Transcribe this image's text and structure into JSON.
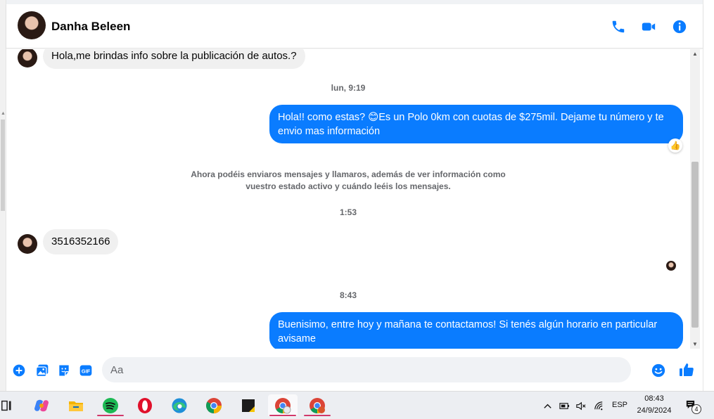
{
  "header": {
    "contact_name": "Danha Beleen",
    "accent_color": "#0a7cff"
  },
  "messages": {
    "incoming_1": "Hola,me brindas info sobre la publicación de autos.?",
    "timestamp_1": "lun, 9:19",
    "outgoing_1_line1": "Hola!! como estas? 😊Es un Polo 0km con cuotas de $275mil. Dejame tu número y te",
    "outgoing_1_line2": "envio mas información",
    "reaction_1": "👍",
    "notice_line1": "Ahora podéis enviaros mensajes y llamaros, además de ver información como",
    "notice_line2": "vuestro estado activo y cuándo leéis los mensajes.",
    "timestamp_2": "1:53",
    "incoming_2": "3516352166",
    "timestamp_3": "8:43",
    "outgoing_2_line1": "Buenisimo, entre hoy y mañana te contactamos! Si tenés algún horario en particular",
    "outgoing_2_line2": "avisame"
  },
  "composer": {
    "placeholder": "Aa",
    "gif_label": "GIF"
  },
  "taskbar": {
    "apps": [
      "copilot-icon",
      "file-explorer-icon",
      "spotify-icon",
      "opera-icon",
      "edge-icon",
      "chrome-icon",
      "sticky-notes-icon",
      "chrome-profile-icon",
      "chrome-profile-2-icon"
    ],
    "language": "ESP",
    "time": "08:43",
    "date": "24/9/2024",
    "notification_count": "4"
  }
}
